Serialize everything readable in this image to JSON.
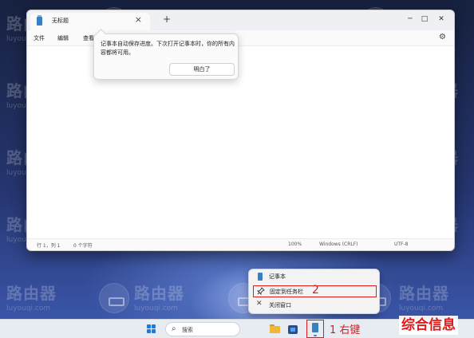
{
  "watermark": {
    "text": "路由器",
    "url": "luyouqi.com"
  },
  "notepad": {
    "tab_title": "无标题",
    "tab_close": "×",
    "new_tab": "+",
    "window_controls": {
      "minimize": "─",
      "maximize": "□",
      "close": "✕"
    },
    "menu": [
      "文件",
      "编辑",
      "查看"
    ],
    "settings_icon": "⚙",
    "status": {
      "position": "行 1，列 1",
      "chars": "0 个字符",
      "zoom": "100%",
      "line_ending": "Windows (CRLF)",
      "encoding": "UTF-8"
    }
  },
  "autosave_tip": {
    "message": "记事本自动保存进度。下次打开记事本时，你的所有内容都将可用。",
    "button": "明白了"
  },
  "jumplist": {
    "items": [
      {
        "label": "记事本",
        "icon": "notepad-icon"
      },
      {
        "label": "固定到任务栏",
        "icon": "pin-icon"
      },
      {
        "label": "关闭窗口",
        "icon": "close-icon"
      }
    ]
  },
  "annotations": {
    "step1": "1 右键",
    "step2": "2"
  },
  "taskbar": {
    "search_placeholder": "搜索",
    "search_icon": "⌕"
  },
  "brand": "综合信息",
  "colors": {
    "annotation_red": "#e0191b",
    "notepad_blue": "#3a7fc1",
    "windows_blue": "#1f7ad8"
  }
}
